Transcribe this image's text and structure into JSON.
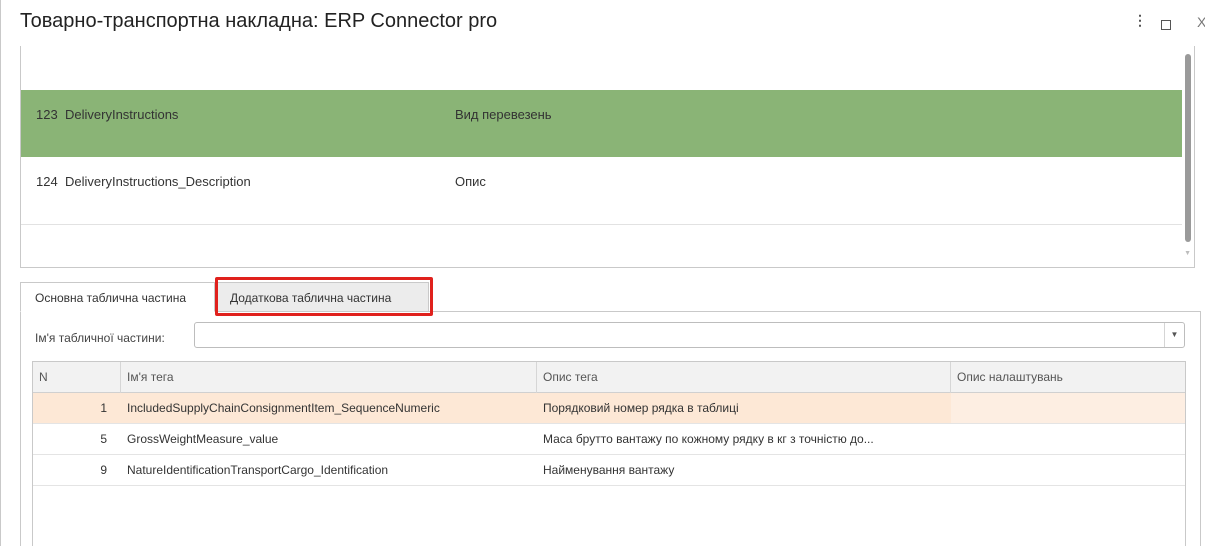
{
  "window": {
    "title": "Товарно-транспортна накладна: ERP Connector pro",
    "menu_icon": "more-vertical-icon",
    "maximize_icon": "maximize-icon",
    "close_icon": "close-icon",
    "close_glyph": "X",
    "menu_glyph": "⋮"
  },
  "upper_list": {
    "rows": [
      {
        "num": "123",
        "name": "DeliveryInstructions",
        "desc": "Вид перевезень",
        "selected": true
      },
      {
        "num": "124",
        "name": "DeliveryInstructions_Description",
        "desc": "Опис",
        "selected": false
      }
    ],
    "selected_color": "#8ab476"
  },
  "tabs": [
    {
      "label": "Основна таблична частина",
      "active": true
    },
    {
      "label": "Додаткова таблична частина",
      "active": false,
      "highlighted": true
    }
  ],
  "highlight_color": "#e0211d",
  "table_part_field": {
    "label": "Ім'я табличної частини:",
    "value": "",
    "dropdown_icon": "chevron-down-icon",
    "dropdown_glyph": "▼"
  },
  "grid": {
    "headers": [
      "N",
      "Ім'я тега",
      "Опис тега",
      "Опис налаштувань"
    ],
    "rows": [
      {
        "n": "1",
        "name": "IncludedSupplyChainConsignmentItem_SequenceNumeric",
        "desc": "Порядковий номер рядка в таблиці",
        "settings": "",
        "current": true
      },
      {
        "n": "5",
        "name": "GrossWeightMeasure_value",
        "desc": "Маса брутто вантажу по кожному рядку в кг з точністю до...",
        "settings": "",
        "current": false
      },
      {
        "n": "9",
        "name": "NatureIdentificationTransportCargo_Identification",
        "desc": "Найменування вантажу",
        "settings": "",
        "current": false
      }
    ],
    "current_row_color": "#fde8d6"
  }
}
